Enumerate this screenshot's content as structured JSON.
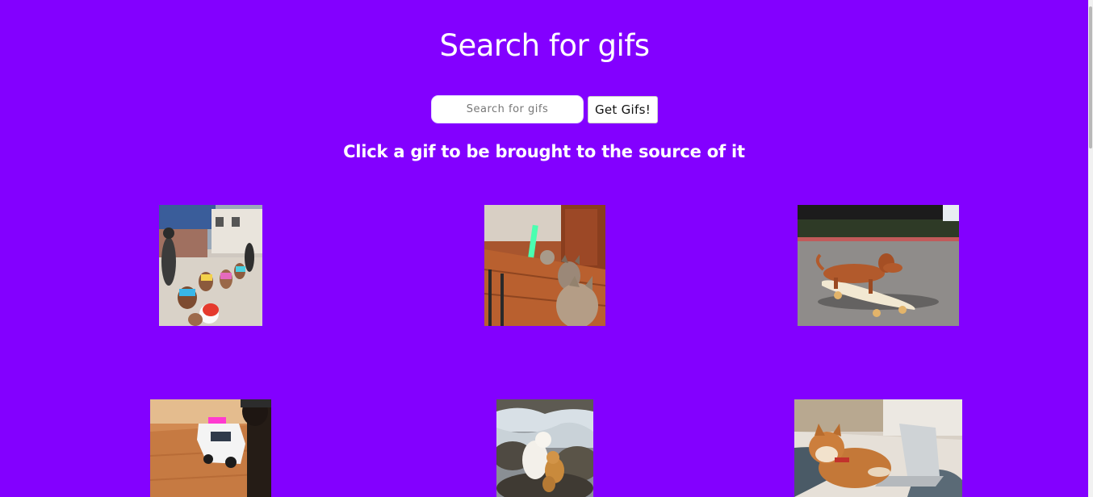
{
  "header": {
    "title": "Search for gifs"
  },
  "search": {
    "placeholder": "Search for gifs",
    "value": "",
    "button_label": "Get Gifs!"
  },
  "instructions": "Click a gif to be brought to the source of it",
  "gifs": [
    {
      "subject": "dogs in costumes walking on hind legs on a street"
    },
    {
      "subject": "dog with lightsaber in a hallway"
    },
    {
      "subject": "dachshund riding a skateboard"
    },
    {
      "subject": "dog and toy police car"
    },
    {
      "subject": "two dogs on rocks by a waterfall"
    },
    {
      "subject": "shiba inu lying on bed with laptop"
    }
  ],
  "colors": {
    "background": "#8300ff",
    "text": "#ffffff",
    "input_background": "#ffffff",
    "button_background": "#ffffff"
  }
}
